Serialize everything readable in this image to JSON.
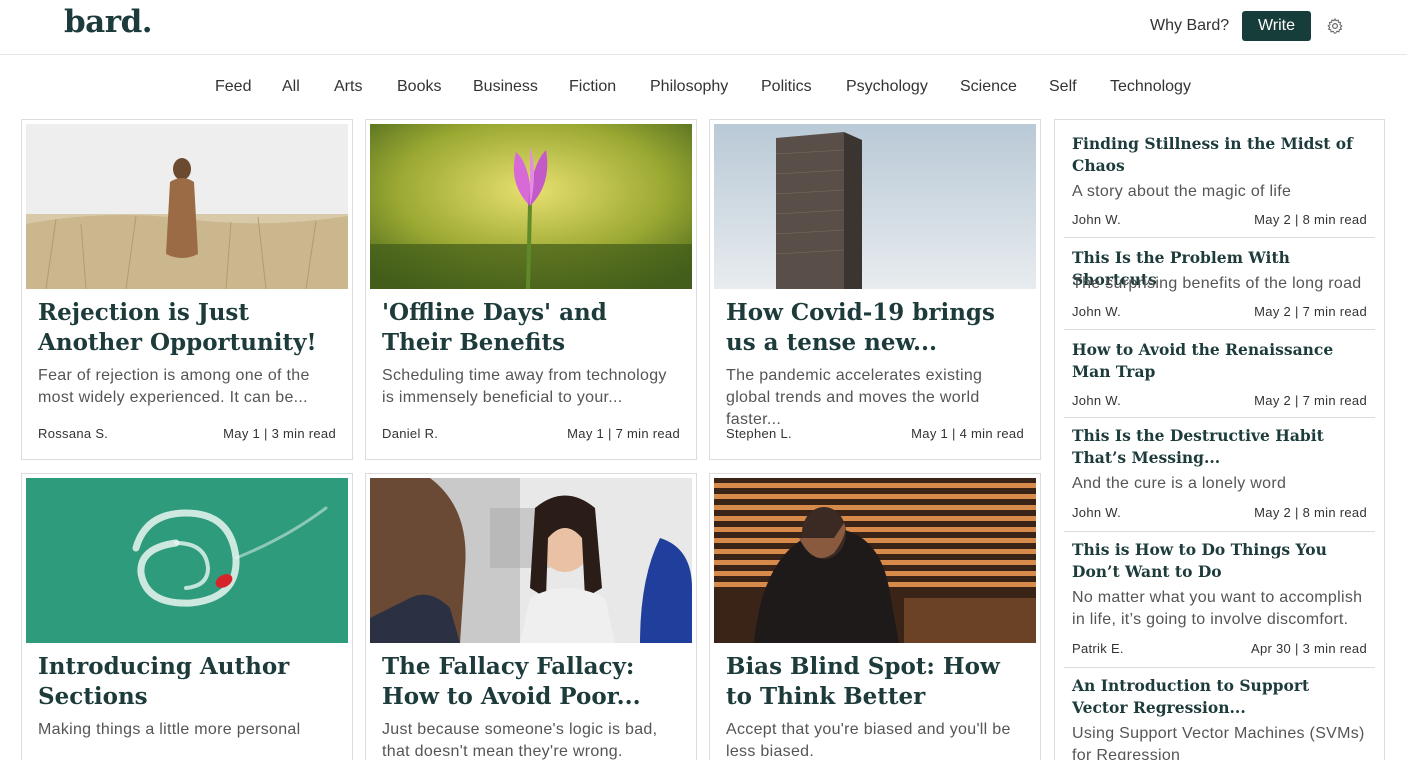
{
  "header": {
    "logo": "bard.",
    "why_link": "Why Bard?",
    "write_label": "Write",
    "settings_icon": "gear-icon"
  },
  "nav": {
    "items": [
      "Feed",
      "All",
      "Arts",
      "Books",
      "Business",
      "Fiction",
      "Philosophy",
      "Politics",
      "Psychology",
      "Science",
      "Self",
      "Technology"
    ],
    "active": "All"
  },
  "cards": [
    {
      "title": "Rejection is Just Another Opportunity!",
      "summary": "Fear of rejection is among one of the most widely experienced. It can be...",
      "author": "Rossana S.",
      "meta": "May 1 | 3 min read"
    },
    {
      "title": "'Offline Days' and Their Benefits",
      "summary": "Scheduling time away from technology is immensely beneficial to your...",
      "author": "Daniel R.",
      "meta": "May 1 | 7 min read"
    },
    {
      "title": "How Covid-19 brings us a tense new...",
      "summary": "The pandemic accelerates existing global trends and moves the world faster...",
      "author": "Stephen L.",
      "meta": "May 1 | 4 min read"
    },
    {
      "title": "Introducing Author Sections",
      "summary": "Making things a little more personal",
      "author": "",
      "meta": ""
    },
    {
      "title": "The Fallacy Fallacy: How to Avoid Poor...",
      "summary": "Just because someone's logic is bad, that doesn't mean they're wrong.",
      "author": "",
      "meta": ""
    },
    {
      "title": "Bias Blind Spot: How to Think Better",
      "summary": "Accept that you're biased and you'll be less biased.",
      "author": "",
      "meta": ""
    }
  ],
  "sidebar": [
    {
      "title": "Finding Stillness in the Midst of Chaos",
      "subtitle": "A story about the magic of life",
      "author": "John W.",
      "meta": "May 2 | 8 min read"
    },
    {
      "title": "This Is the Problem With Shortcuts",
      "subtitle": "The surprising benefits of the long road",
      "author": "John W.",
      "meta": "May 2 | 7 min read"
    },
    {
      "title": "How to Avoid the Renaissance Man Trap",
      "subtitle": "",
      "author": "John W.",
      "meta": "May 2 | 7 min read"
    },
    {
      "title": "This Is the Destructive Habit That’s Messing...",
      "subtitle": "And the cure is a lonely word",
      "author": "John W.",
      "meta": "May 2 | 8 min read"
    },
    {
      "title": "This is How to Do Things You Don’t Want to Do",
      "subtitle": "No matter what you want to accomplish in life, it’s going to involve discomfort.",
      "author": "Patrik E.",
      "meta": "Apr 30 | 3 min read"
    },
    {
      "title": "An Introduction to Support Vector Regression...",
      "subtitle": "Using Support Vector Machines (SVMs) for Regression",
      "author": "",
      "meta": ""
    }
  ],
  "colors": {
    "brand": "#1d3b3b",
    "write_button": "#173d3a",
    "border": "#dcdcdc"
  }
}
